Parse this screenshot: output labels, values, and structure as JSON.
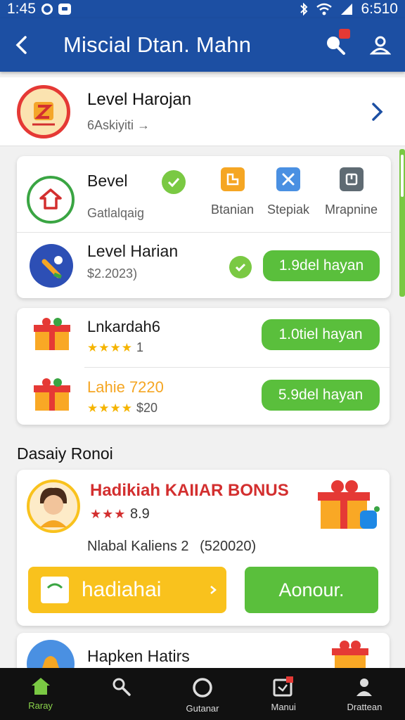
{
  "status_bar": {
    "time": "1:45",
    "right_time": "6:510"
  },
  "app_bar": {
    "title": "Miscial Dtan. Mahn"
  },
  "header": {
    "title": "Level Harojan",
    "subtitle": "6Askiyiti"
  },
  "card1": {
    "badge_title": "Bevel",
    "badge_sub": "Gatlalqaig",
    "tools": [
      {
        "label": "Btanian",
        "icon": "grid-icon",
        "color": "#f5a623"
      },
      {
        "label": "Stepiak",
        "icon": "tools-icon",
        "color": "#4a90e2"
      },
      {
        "label": "Mrapnine",
        "icon": "book-icon",
        "color": "#5f6b73"
      }
    ],
    "task": {
      "title": "Level Harian",
      "subtitle": "$2.2023)",
      "button": "1.9del hayan"
    }
  },
  "card2": {
    "items": [
      {
        "title": "Lnkardah6",
        "rating": "1",
        "button": "1.0tiel hayan",
        "highlight": false
      },
      {
        "title": "Lahie 7220",
        "rating": "$20",
        "button": "5.9del hayan",
        "highlight": true
      }
    ]
  },
  "section": {
    "title": "Dasaiy Ronoi"
  },
  "bonus": {
    "title": "Hadikiah KAIIAR BONUS",
    "rating": "8.9",
    "meta_name": "Nlabal Kaliens 2",
    "meta_value": "(520020)",
    "primary_button": "hadiahai",
    "secondary_button": "Aonour."
  },
  "card4": {
    "title": "Hapken Hatirs"
  },
  "bottom_nav": [
    {
      "label": "Raray",
      "icon": "home-icon",
      "active": true
    },
    {
      "label": "",
      "icon": "search-icon",
      "active": false
    },
    {
      "label": "Gutanar",
      "icon": "circle-icon",
      "active": false
    },
    {
      "label": "Manui",
      "icon": "inbox-icon",
      "active": false
    },
    {
      "label": "Drattean",
      "icon": "profile-icon",
      "active": false
    }
  ],
  "colors": {
    "primary": "#1c4fa3",
    "accent_green": "#5abf3c",
    "accent_yellow": "#f9c21d",
    "bonus_red": "#d32f2f"
  }
}
